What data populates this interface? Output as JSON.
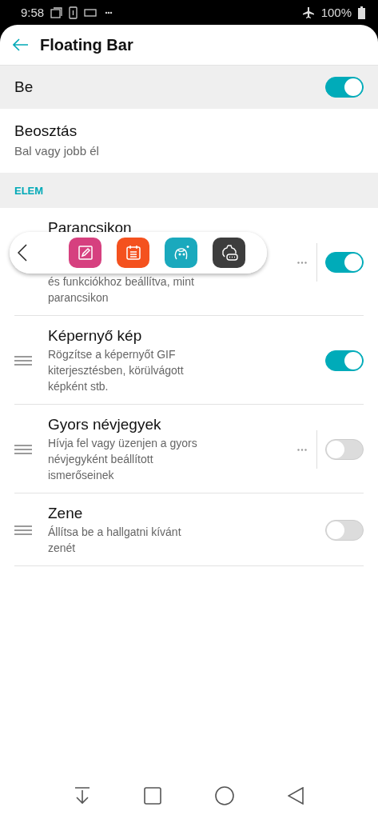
{
  "status_bar": {
    "time": "9:58",
    "battery": "100%"
  },
  "header": {
    "title": "Floating Bar"
  },
  "master": {
    "label": "Be",
    "on": true
  },
  "position": {
    "title": "Beosztás",
    "subtitle": "Bal vagy jobb él"
  },
  "section": {
    "label": "ELEM"
  },
  "items": [
    {
      "title": "Parancsikon",
      "description": "és funkciókhoz beállítva, mint parancsikon",
      "on": true,
      "more": true
    },
    {
      "title": "Képernyő kép",
      "description": "Rögzítse a képernyőt GIF kiterjesztésben, körülvágott képként stb.",
      "on": true,
      "more": false
    },
    {
      "title": "Gyors névjegyek",
      "description": "Hívja fel vagy üzenjen a gyors névjegyként beállított ismerőseinek",
      "on": false,
      "more": true
    },
    {
      "title": "Zene",
      "description": "Állítsa be a hallgatni kívánt zenét",
      "on": false,
      "more": false
    }
  ],
  "floating_bar": {
    "apps": [
      {
        "kind": "memo",
        "color": "#d6407f"
      },
      {
        "kind": "calendar",
        "color": "#f4511e"
      },
      {
        "kind": "face",
        "color": "#1aa9bd"
      },
      {
        "kind": "settings",
        "color": "#3d3d3d"
      }
    ]
  }
}
